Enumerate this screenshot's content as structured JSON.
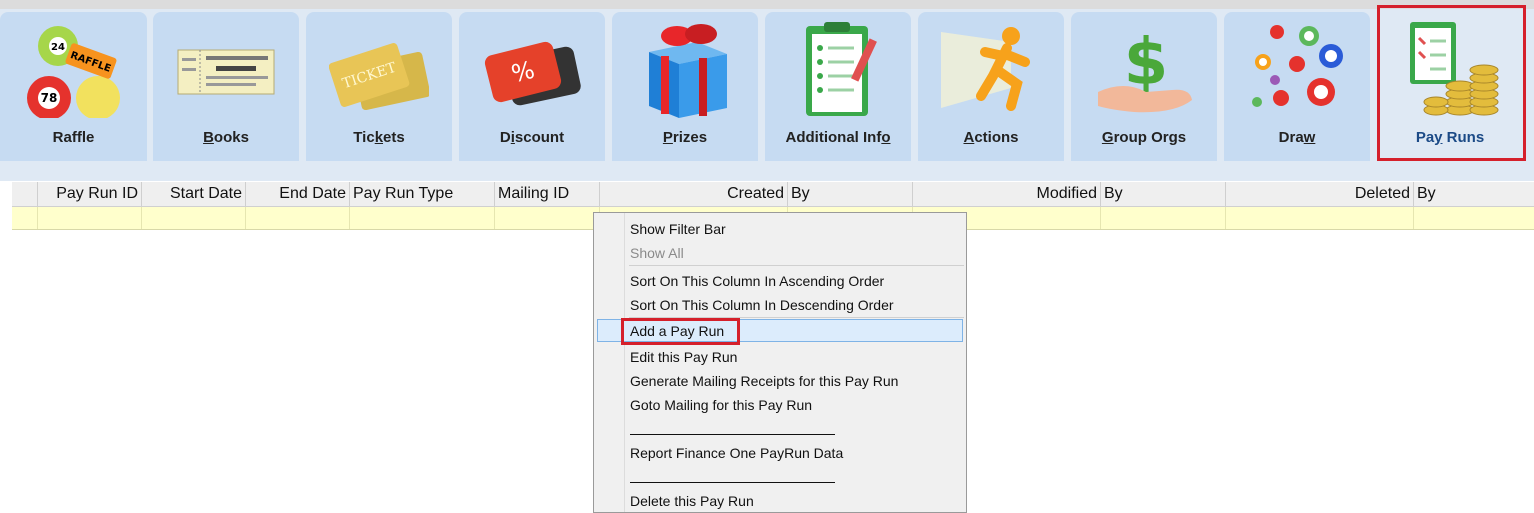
{
  "ribbon": {
    "tabs": [
      {
        "pre": "Raffle",
        "u": "",
        "post": "",
        "icon": "raffle-balls-icon"
      },
      {
        "pre": "",
        "u": "B",
        "post": "ooks",
        "icon": "book-ticket-icon"
      },
      {
        "pre": "Tic",
        "u": "k",
        "post": "ets",
        "icon": "ticket-icon"
      },
      {
        "pre": "D",
        "u": "i",
        "post": "scount",
        "icon": "discount-percent-icon"
      },
      {
        "pre": "",
        "u": "P",
        "post": "rizes",
        "icon": "gift-box-icon"
      },
      {
        "pre": "Additional Inf",
        "u": "o",
        "post": "",
        "icon": "clipboard-checklist-icon"
      },
      {
        "pre": "",
        "u": "A",
        "post": "ctions",
        "icon": "running-man-icon"
      },
      {
        "pre": "",
        "u": "G",
        "post": "roup Orgs",
        "icon": "money-hand-icon"
      },
      {
        "pre": "Dra",
        "u": "w",
        "post": "",
        "icon": "lottery-balls-icon"
      },
      {
        "pre": "Pa",
        "u": "y",
        "post": " Runs",
        "icon": "clipboard-coins-icon"
      }
    ],
    "active_tab": 9
  },
  "grid": {
    "columns": [
      {
        "label": "Pay Run ID",
        "align": "right"
      },
      {
        "label": "Start Date",
        "align": "right"
      },
      {
        "label": "End Date",
        "align": "right"
      },
      {
        "label": "Pay Run Type",
        "align": "left"
      },
      {
        "label": "Mailing ID",
        "align": "left"
      },
      {
        "label": "Created",
        "align": "right"
      },
      {
        "label": "By",
        "align": "left"
      },
      {
        "label": "Modified",
        "align": "right"
      },
      {
        "label": "By",
        "align": "left"
      },
      {
        "label": "Deleted",
        "align": "right"
      },
      {
        "label": "By",
        "align": "left"
      }
    ]
  },
  "context_menu": {
    "show_filter_bar": "Show Filter Bar",
    "show_all": "Show All",
    "sort_asc": "Sort On This Column In Ascending Order",
    "sort_desc": "Sort On This Column In Descending Order",
    "add_pay_run": "Add a Pay Run",
    "edit_pay_run": "Edit this Pay Run",
    "generate_receipts": "Generate Mailing Receipts for this Pay Run",
    "goto_mailing": "Goto Mailing for this Pay Run",
    "report_finance": "Report Finance One PayRun Data",
    "delete_pay_run": "Delete this Pay Run"
  },
  "colors": {
    "highlight": "#d5202b",
    "tab": "#c6dbf2",
    "filter_row": "#ffffcc",
    "hover": "#dcecfc"
  }
}
